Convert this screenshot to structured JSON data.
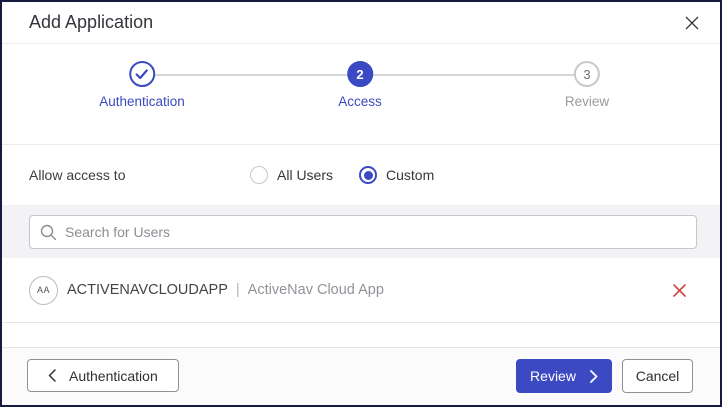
{
  "dialog": {
    "title": "Add Application"
  },
  "stepper": {
    "steps": [
      {
        "label": "Authentication",
        "state": "completed",
        "indicator": "check"
      },
      {
        "label": "Access",
        "state": "active",
        "indicator": "2"
      },
      {
        "label": "Review",
        "state": "upcoming",
        "indicator": "3"
      }
    ]
  },
  "access": {
    "label": "Allow access to",
    "options": [
      {
        "label": "All Users",
        "selected": false
      },
      {
        "label": "Custom",
        "selected": true
      }
    ]
  },
  "search": {
    "placeholder": "Search for Users"
  },
  "users": [
    {
      "avatar_initials": "AA",
      "name": "ACTIVENAVCLOUDAPP",
      "separator": "|",
      "description": "ActiveNav Cloud App"
    }
  ],
  "footer": {
    "back_label": "Authentication",
    "review_label": "Review",
    "cancel_label": "Cancel"
  },
  "colors": {
    "accent": "#3b4ac2",
    "danger": "#d24444",
    "dialog_border": "#151a3e",
    "band_background": "#f3f3f5"
  }
}
